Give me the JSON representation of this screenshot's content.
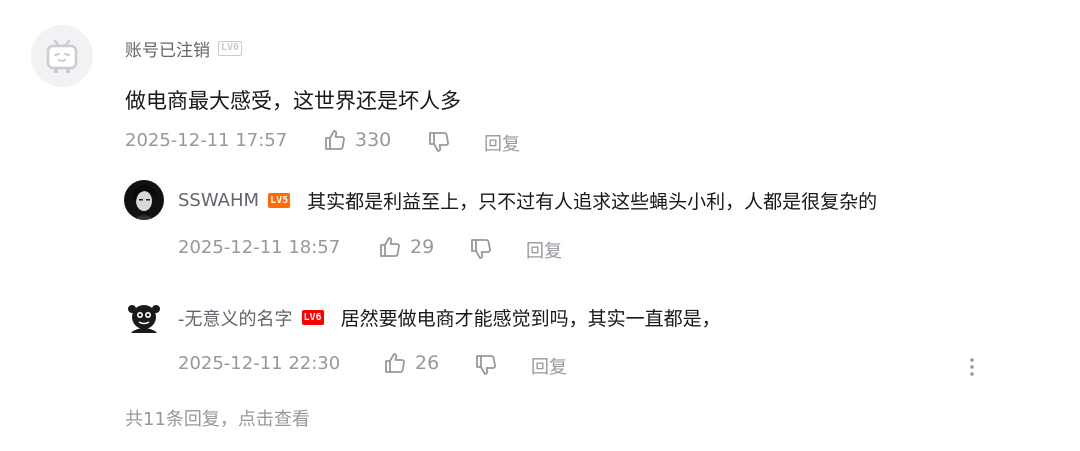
{
  "comment": {
    "username": "账号已注销",
    "level": "LV0",
    "text": "做电商最大感受，这世界还是坏人多",
    "time": "2025-12-11 17:57",
    "likes": "330",
    "reply_label": "回复"
  },
  "replies": [
    {
      "username": "SSWAHM",
      "level": "LV5",
      "text": "其实都是利益至上，只不过有人追求这些蝇头小利，人都是很复杂的",
      "time": "2025-12-11 18:57",
      "likes": "29",
      "reply_label": "回复"
    },
    {
      "username": "-无意义的名字",
      "level": "LV6",
      "text": "居然要做电商才能感觉到吗，其实一直都是，",
      "time": "2025-12-11 22:30",
      "likes": "26",
      "reply_label": "回复"
    }
  ],
  "summary": "共11条回复，点击查看",
  "icons": {
    "main_avatar": "tv-placeholder-avatar-icon",
    "like": "thumbs-up-icon",
    "dislike": "thumbs-down-icon",
    "more": "more-vertical-icon"
  },
  "colors": {
    "text": "#18191c",
    "meta": "#9499a0",
    "level0": "#c9ccd0",
    "level5": "#ff6c00",
    "level6": "#ff0000"
  }
}
